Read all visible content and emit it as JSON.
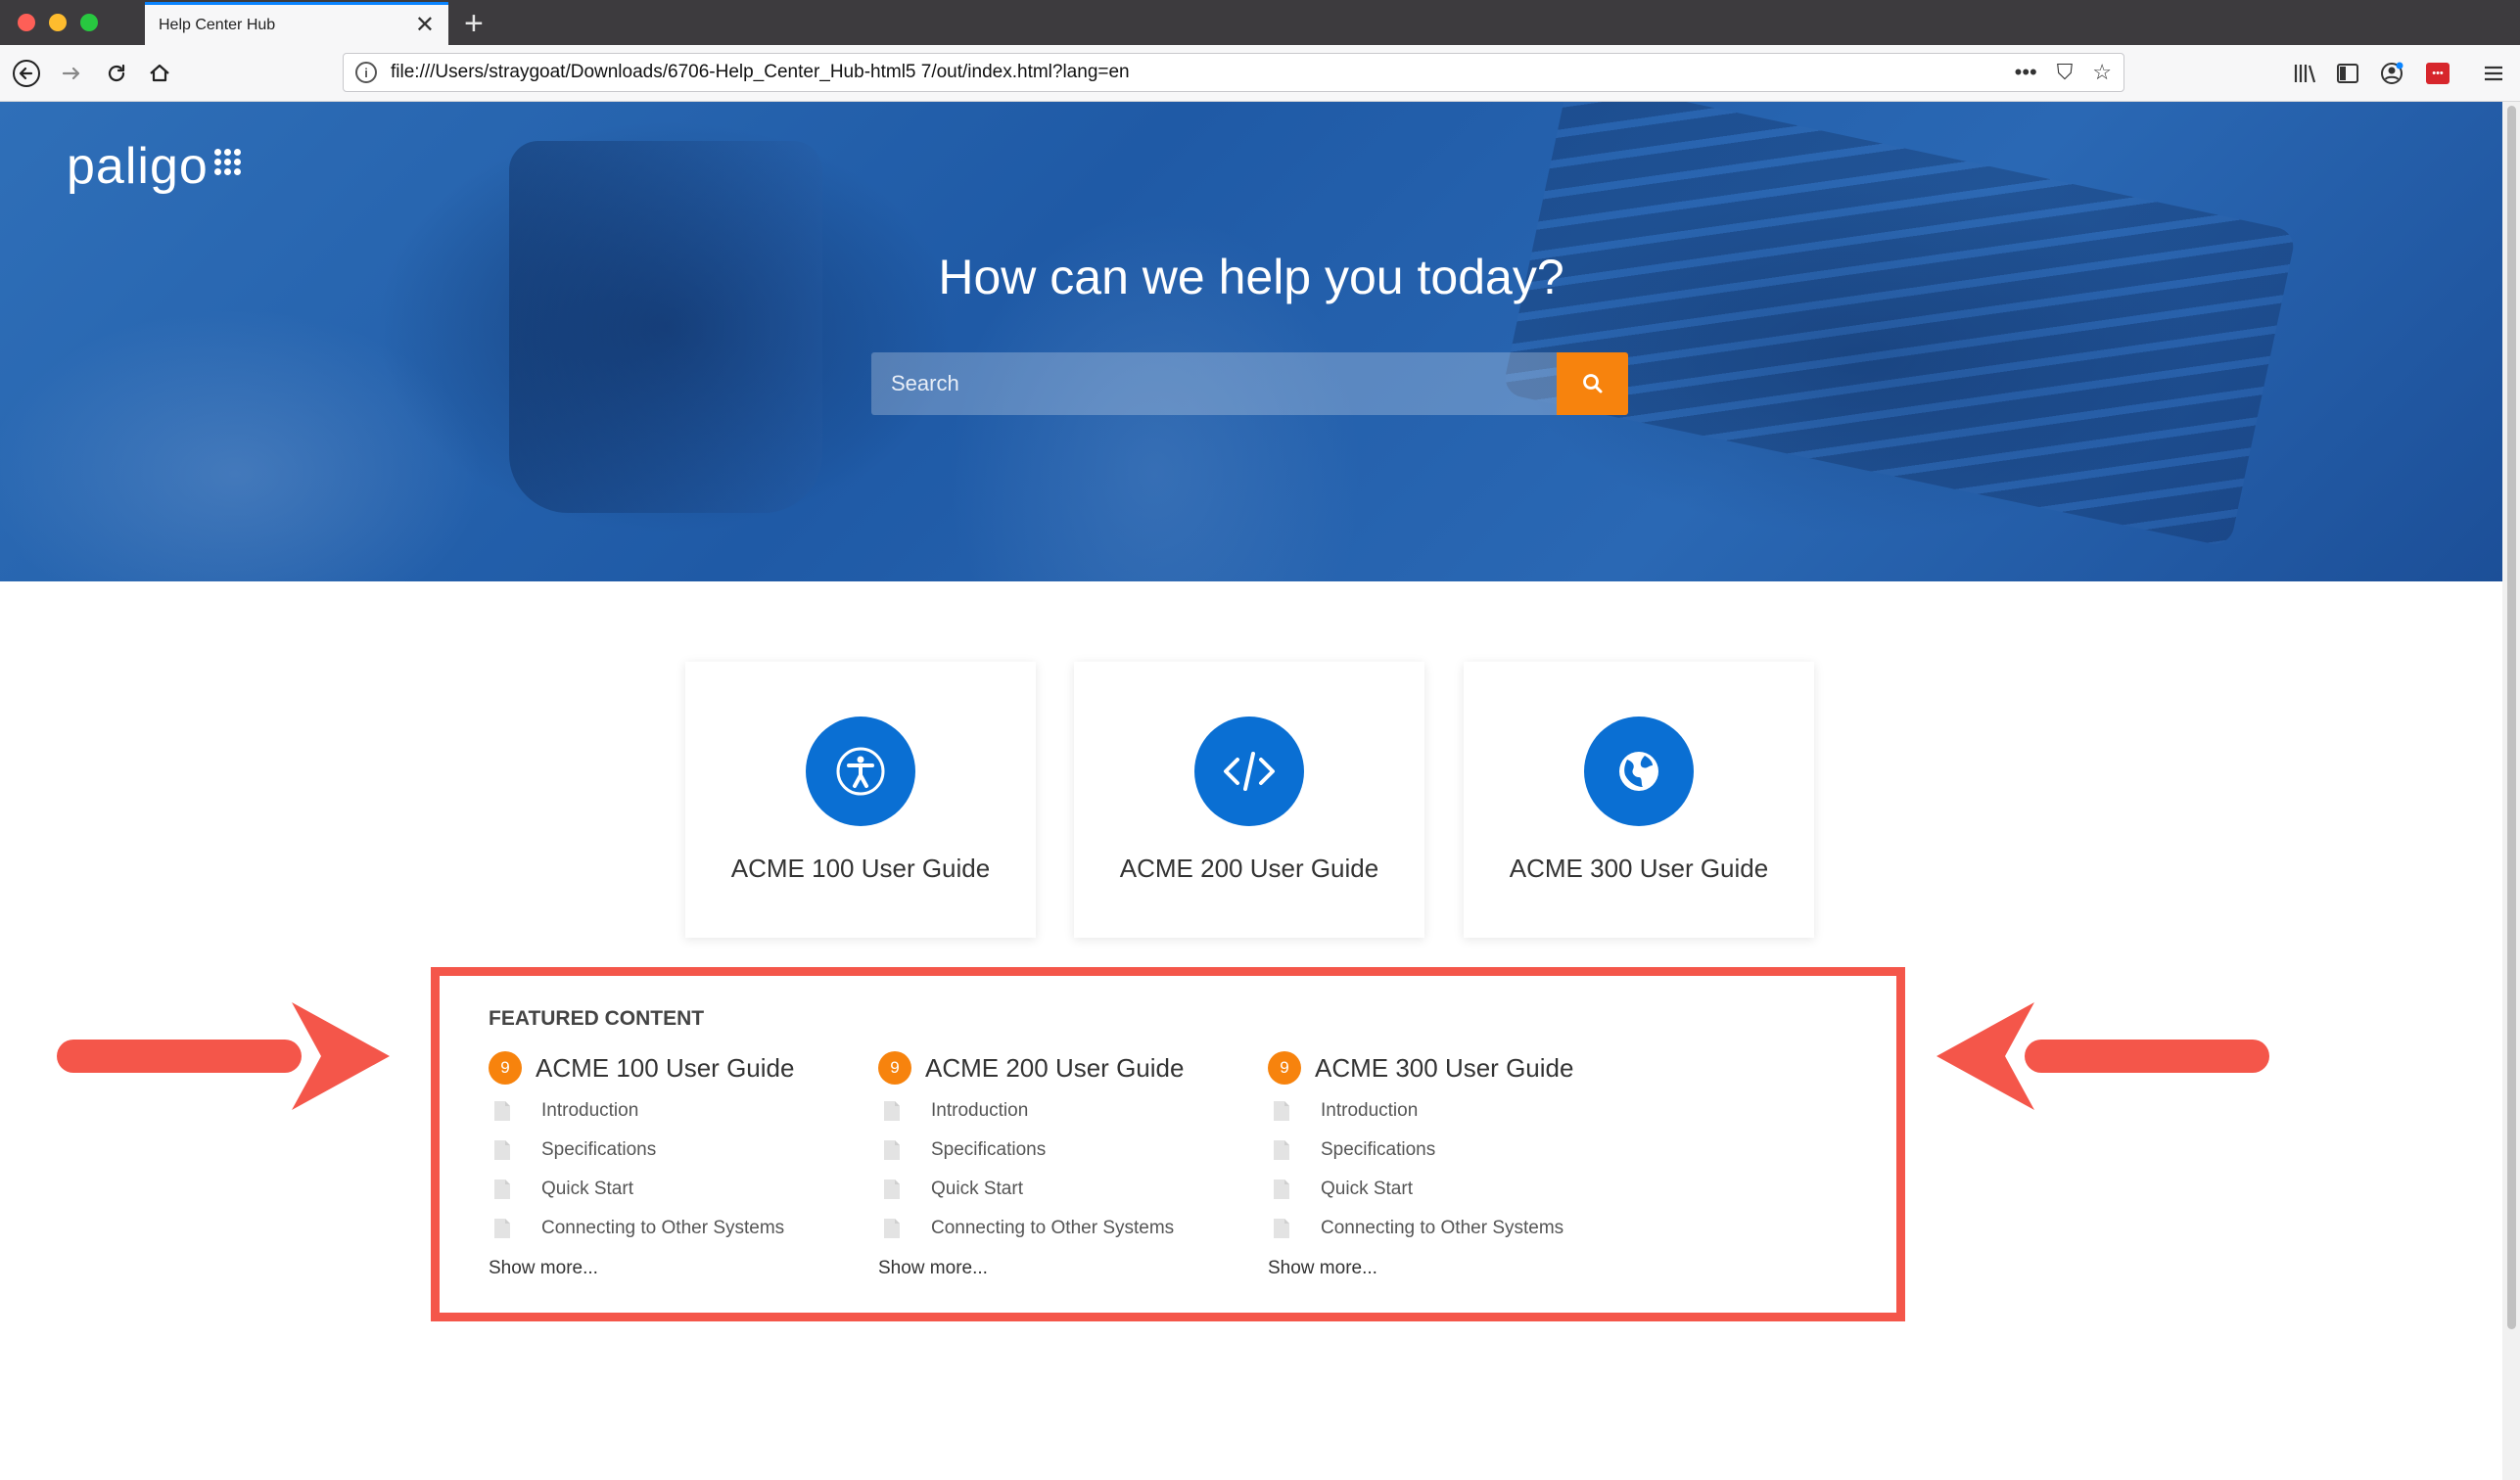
{
  "browser": {
    "tab_title": "Help Center Hub",
    "tab_close": "✕",
    "new_tab": "+",
    "url": "file:///Users/straygoat/Downloads/6706-Help_Center_Hub-html5 7/out/index.html?lang=en",
    "url_actions": [
      "•••",
      "⛉",
      "☆"
    ],
    "icons": [
      "back-icon",
      "forward-icon",
      "reload-icon",
      "home-icon",
      "library-icon",
      "sidebar-icon",
      "account-icon",
      "extension-icon",
      "menu-icon"
    ]
  },
  "hero": {
    "logo_text": "paligo",
    "title": "How can we help you today?",
    "search_placeholder": "Search"
  },
  "guides": [
    {
      "label": "ACME 100 User Guide",
      "icon": "accessibility-icon"
    },
    {
      "label": "ACME 200 User Guide",
      "icon": "code-icon"
    },
    {
      "label": "ACME 300 User Guide",
      "icon": "globe-icon"
    }
  ],
  "featured": {
    "heading": "FEATURED CONTENT",
    "columns": [
      {
        "badge": "9",
        "title": "ACME 100 User Guide",
        "items": [
          "Introduction",
          "Specifications",
          "Quick Start",
          "Connecting to Other Systems"
        ],
        "show_more": "Show more..."
      },
      {
        "badge": "9",
        "title": "ACME 200 User Guide",
        "items": [
          "Introduction",
          "Specifications",
          "Quick Start",
          "Connecting to Other Systems"
        ],
        "show_more": "Show more..."
      },
      {
        "badge": "9",
        "title": "ACME 300 User Guide",
        "items": [
          "Introduction",
          "Specifications",
          "Quick Start",
          "Connecting to Other Systems"
        ],
        "show_more": "Show more..."
      }
    ]
  },
  "colors": {
    "accent_orange": "#f7830d",
    "icon_blue": "#0a6fd3",
    "highlight_red": "#f4564a",
    "hero_blue": "#2a68b4"
  }
}
